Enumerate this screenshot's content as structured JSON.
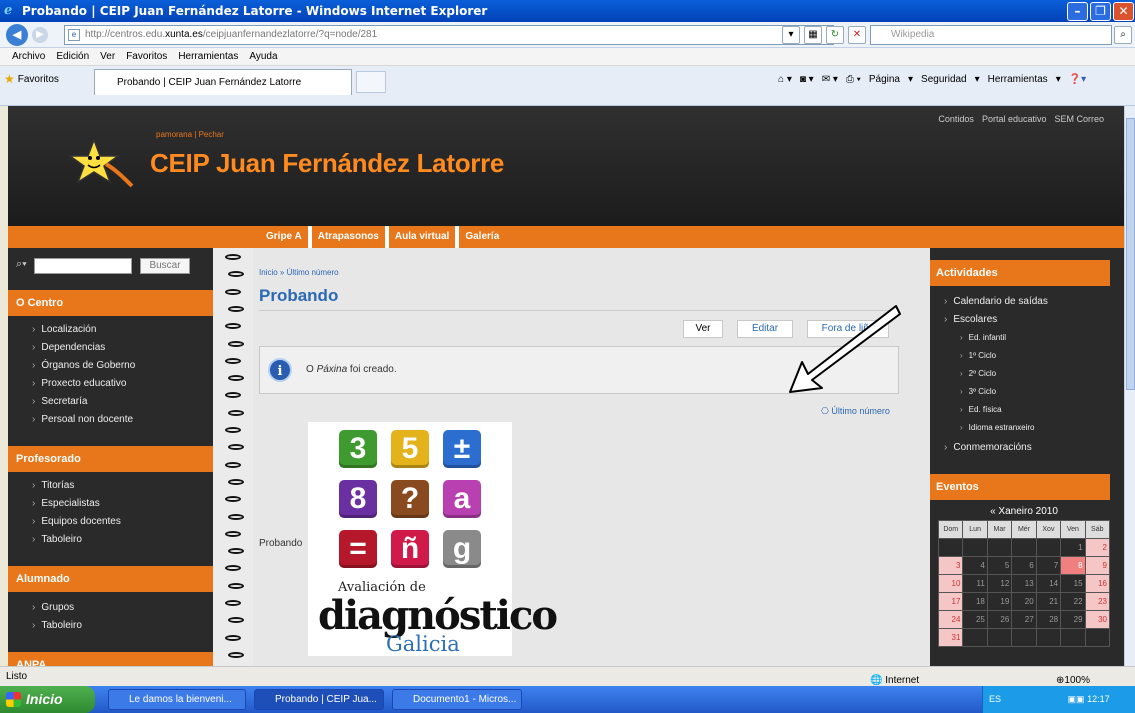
{
  "window": {
    "title": "Probando | CEIP Juan Fernández Latorre - Windows Internet Explorer"
  },
  "address": {
    "prefix": "http://centros.edu.",
    "domain": "xunta.es",
    "path": "/ceipjuanfernandezlatorre/?q=node/281",
    "search_placeholder": "Wikipedia"
  },
  "menu": [
    "Archivo",
    "Edición",
    "Ver",
    "Favoritos",
    "Herramientas",
    "Ayuda"
  ],
  "favorites_label": "Favoritos",
  "tab_label": "Probando | CEIP Juan Fernández Latorre",
  "command_bar": {
    "page": "Página",
    "security": "Seguridad",
    "tools": "Herramientas"
  },
  "site": {
    "top_links": [
      "Contidos",
      "Portal educativo",
      "SEM Correo"
    ],
    "login": [
      "pamorana",
      "Pechar"
    ],
    "title": "CEIP Juan Fernández Latorre",
    "nav": [
      "Gripe A",
      "Atrapasonos",
      "Aula virtual",
      "Galería"
    ],
    "search_button": "Buscar",
    "left": {
      "sections": [
        {
          "title": "O Centro",
          "items": [
            "Localización",
            "Dependencias",
            "Órganos de Goberno",
            "Proxecto educativo",
            "Secretaría",
            "Persoal non docente"
          ]
        },
        {
          "title": "Profesorado",
          "items": [
            "Titorías",
            "Especialistas",
            "Equipos docentes",
            "Taboleiro"
          ]
        },
        {
          "title": "Alumnado",
          "items": [
            "Grupos",
            "Taboleiro"
          ]
        },
        {
          "title": "ANPA",
          "items": []
        }
      ]
    },
    "main": {
      "breadcrumb": "Inicio » Último número",
      "title": "Probando",
      "tabs": [
        "Ver",
        "Editar",
        "Fora de liña"
      ],
      "message_prefix": "O ",
      "message_em": "Páxina",
      "message_suffix": " foi creado.",
      "ultimo_link": "Último número",
      "body_text": "Probando",
      "image_tiles": [
        "3",
        "5",
        "±",
        "8",
        "?",
        "a",
        "=",
        "ñ",
        "g"
      ],
      "image_caption_1": "Avaliación de",
      "image_caption_2": "diagnóstico",
      "image_caption_3": "Galicia"
    },
    "right": {
      "actividades_title": "Actividades",
      "actividades": [
        "Calendario de saídas",
        "Escolares",
        "Conmemoracións"
      ],
      "escolares_sub": [
        "Ed. infantil",
        "1º Ciclo",
        "2º Ciclo",
        "3º Ciclo",
        "Ed. física",
        "Idioma estranxeiro"
      ],
      "eventos_title": "Eventos",
      "calendar": {
        "month": "« Xaneiro 2010",
        "days": [
          "Dom",
          "Lun",
          "Mar",
          "Mér",
          "Xov",
          "Ven",
          "Sáb"
        ],
        "weeks": [
          [
            "",
            "",
            "",
            "",
            "",
            "1",
            "2"
          ],
          [
            "3",
            "4",
            "5",
            "6",
            "7",
            "8",
            "9"
          ],
          [
            "10",
            "11",
            "12",
            "13",
            "14",
            "15",
            "16"
          ],
          [
            "17",
            "18",
            "19",
            "20",
            "21",
            "22",
            "23"
          ],
          [
            "24",
            "25",
            "26",
            "27",
            "28",
            "29",
            "30"
          ],
          [
            "31",
            "",
            "",
            "",
            "",
            "",
            ""
          ]
        ],
        "today": "8"
      }
    }
  },
  "status": {
    "text": "Listo",
    "zone": "Internet",
    "zoom": "100%"
  },
  "taskbar": {
    "start": "Inicio",
    "tasks": [
      "Le damos la bienveni...",
      "Probando | CEIP Jua...",
      "Documento1 - Micros..."
    ],
    "lang": "ES",
    "time": "12:17"
  },
  "colors": {
    "accent": "#e8761a",
    "link": "#2b68b5"
  }
}
